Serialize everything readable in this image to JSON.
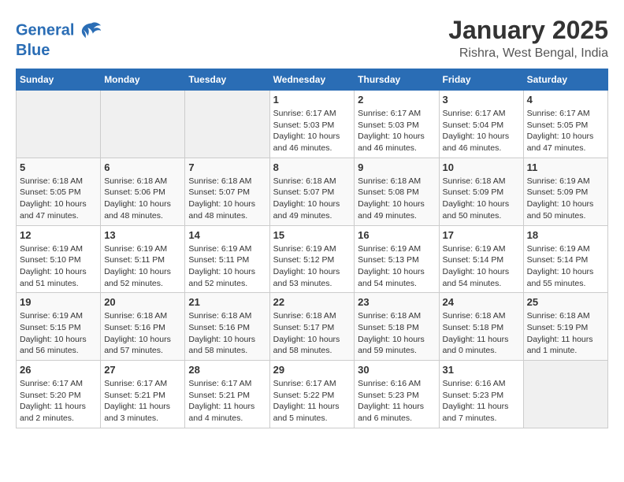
{
  "logo": {
    "line1": "General",
    "line2": "Blue"
  },
  "title": "January 2025",
  "subtitle": "Rishra, West Bengal, India",
  "days_of_week": [
    "Sunday",
    "Monday",
    "Tuesday",
    "Wednesday",
    "Thursday",
    "Friday",
    "Saturday"
  ],
  "weeks": [
    [
      {
        "day": "",
        "info": ""
      },
      {
        "day": "",
        "info": ""
      },
      {
        "day": "",
        "info": ""
      },
      {
        "day": "1",
        "info": "Sunrise: 6:17 AM\nSunset: 5:03 PM\nDaylight: 10 hours\nand 46 minutes."
      },
      {
        "day": "2",
        "info": "Sunrise: 6:17 AM\nSunset: 5:03 PM\nDaylight: 10 hours\nand 46 minutes."
      },
      {
        "day": "3",
        "info": "Sunrise: 6:17 AM\nSunset: 5:04 PM\nDaylight: 10 hours\nand 46 minutes."
      },
      {
        "day": "4",
        "info": "Sunrise: 6:17 AM\nSunset: 5:05 PM\nDaylight: 10 hours\nand 47 minutes."
      }
    ],
    [
      {
        "day": "5",
        "info": "Sunrise: 6:18 AM\nSunset: 5:05 PM\nDaylight: 10 hours\nand 47 minutes."
      },
      {
        "day": "6",
        "info": "Sunrise: 6:18 AM\nSunset: 5:06 PM\nDaylight: 10 hours\nand 48 minutes."
      },
      {
        "day": "7",
        "info": "Sunrise: 6:18 AM\nSunset: 5:07 PM\nDaylight: 10 hours\nand 48 minutes."
      },
      {
        "day": "8",
        "info": "Sunrise: 6:18 AM\nSunset: 5:07 PM\nDaylight: 10 hours\nand 49 minutes."
      },
      {
        "day": "9",
        "info": "Sunrise: 6:18 AM\nSunset: 5:08 PM\nDaylight: 10 hours\nand 49 minutes."
      },
      {
        "day": "10",
        "info": "Sunrise: 6:18 AM\nSunset: 5:09 PM\nDaylight: 10 hours\nand 50 minutes."
      },
      {
        "day": "11",
        "info": "Sunrise: 6:19 AM\nSunset: 5:09 PM\nDaylight: 10 hours\nand 50 minutes."
      }
    ],
    [
      {
        "day": "12",
        "info": "Sunrise: 6:19 AM\nSunset: 5:10 PM\nDaylight: 10 hours\nand 51 minutes."
      },
      {
        "day": "13",
        "info": "Sunrise: 6:19 AM\nSunset: 5:11 PM\nDaylight: 10 hours\nand 52 minutes."
      },
      {
        "day": "14",
        "info": "Sunrise: 6:19 AM\nSunset: 5:11 PM\nDaylight: 10 hours\nand 52 minutes."
      },
      {
        "day": "15",
        "info": "Sunrise: 6:19 AM\nSunset: 5:12 PM\nDaylight: 10 hours\nand 53 minutes."
      },
      {
        "day": "16",
        "info": "Sunrise: 6:19 AM\nSunset: 5:13 PM\nDaylight: 10 hours\nand 54 minutes."
      },
      {
        "day": "17",
        "info": "Sunrise: 6:19 AM\nSunset: 5:14 PM\nDaylight: 10 hours\nand 54 minutes."
      },
      {
        "day": "18",
        "info": "Sunrise: 6:19 AM\nSunset: 5:14 PM\nDaylight: 10 hours\nand 55 minutes."
      }
    ],
    [
      {
        "day": "19",
        "info": "Sunrise: 6:19 AM\nSunset: 5:15 PM\nDaylight: 10 hours\nand 56 minutes."
      },
      {
        "day": "20",
        "info": "Sunrise: 6:18 AM\nSunset: 5:16 PM\nDaylight: 10 hours\nand 57 minutes."
      },
      {
        "day": "21",
        "info": "Sunrise: 6:18 AM\nSunset: 5:16 PM\nDaylight: 10 hours\nand 58 minutes."
      },
      {
        "day": "22",
        "info": "Sunrise: 6:18 AM\nSunset: 5:17 PM\nDaylight: 10 hours\nand 58 minutes."
      },
      {
        "day": "23",
        "info": "Sunrise: 6:18 AM\nSunset: 5:18 PM\nDaylight: 10 hours\nand 59 minutes."
      },
      {
        "day": "24",
        "info": "Sunrise: 6:18 AM\nSunset: 5:18 PM\nDaylight: 11 hours\nand 0 minutes."
      },
      {
        "day": "25",
        "info": "Sunrise: 6:18 AM\nSunset: 5:19 PM\nDaylight: 11 hours\nand 1 minute."
      }
    ],
    [
      {
        "day": "26",
        "info": "Sunrise: 6:17 AM\nSunset: 5:20 PM\nDaylight: 11 hours\nand 2 minutes."
      },
      {
        "day": "27",
        "info": "Sunrise: 6:17 AM\nSunset: 5:21 PM\nDaylight: 11 hours\nand 3 minutes."
      },
      {
        "day": "28",
        "info": "Sunrise: 6:17 AM\nSunset: 5:21 PM\nDaylight: 11 hours\nand 4 minutes."
      },
      {
        "day": "29",
        "info": "Sunrise: 6:17 AM\nSunset: 5:22 PM\nDaylight: 11 hours\nand 5 minutes."
      },
      {
        "day": "30",
        "info": "Sunrise: 6:16 AM\nSunset: 5:23 PM\nDaylight: 11 hours\nand 6 minutes."
      },
      {
        "day": "31",
        "info": "Sunrise: 6:16 AM\nSunset: 5:23 PM\nDaylight: 11 hours\nand 7 minutes."
      },
      {
        "day": "",
        "info": ""
      }
    ]
  ]
}
